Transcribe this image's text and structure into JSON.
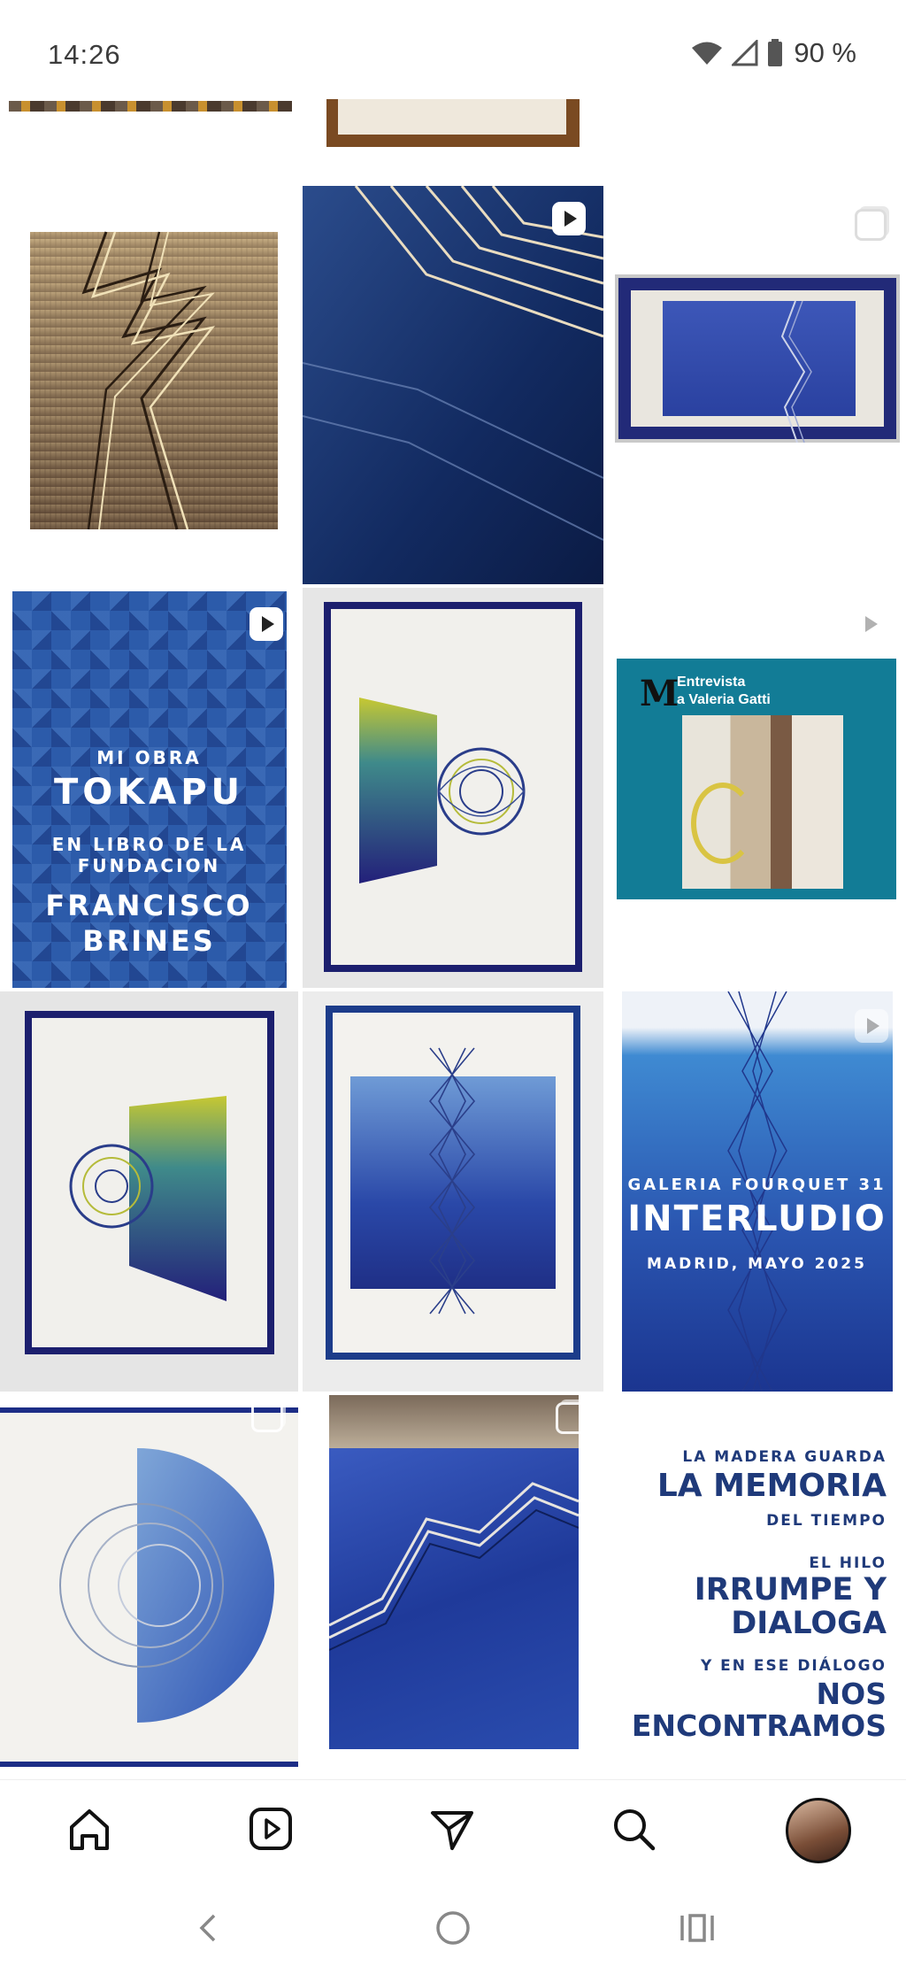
{
  "status_bar": {
    "time": "14:26",
    "battery_percent": "90 %",
    "icons": [
      "wifi-icon",
      "signal-icon",
      "battery-icon"
    ]
  },
  "posts": [
    {
      "name": "weave-top-partial",
      "type": "image"
    },
    {
      "name": "frame-top-partial",
      "type": "image"
    },
    {
      "name": "gold-thread-weave",
      "type": "image"
    },
    {
      "name": "blue-thread-closeup",
      "type": "reel"
    },
    {
      "name": "framed-blue-zigzag",
      "type": "carousel"
    },
    {
      "name": "tokapu-book",
      "type": "reel",
      "lines": [
        "MI OBRA",
        "TOKAPU",
        "EN LIBRO DE LA",
        "FUNDACION",
        "FRANCISCO",
        "BRINES"
      ]
    },
    {
      "name": "framed-spiral-yellow",
      "type": "image"
    },
    {
      "name": "interview-valeria",
      "type": "reel",
      "logo": "M",
      "title_line1": "Entrevista",
      "title_line2": "a Valeria Gatti"
    },
    {
      "name": "framed-spiral-left",
      "type": "image"
    },
    {
      "name": "framed-diamond-weave",
      "type": "image"
    },
    {
      "name": "interludio-poster",
      "type": "reel",
      "line1": "GALERIA FOURQUET 31",
      "line2": "INTERLUDIO",
      "line3": "MADRID, MAYO 2025"
    },
    {
      "name": "half-circle-spiral",
      "type": "carousel"
    },
    {
      "name": "blue-zigzag-table",
      "type": "carousel"
    },
    {
      "name": "memoria-quote",
      "type": "image",
      "lines": [
        "LA MADERA GUARDA",
        "LA MEMORIA",
        "DEL TIEMPO",
        "EL HILO",
        "IRRUMPE Y",
        "DIALOGA",
        "Y EN ESE DIÁLOGO",
        "NOS",
        "ENCONTRAMOS"
      ]
    }
  ],
  "bottom_nav": {
    "items": [
      "home-icon",
      "reels-icon",
      "send-icon",
      "search-icon",
      "profile-avatar"
    ]
  },
  "system_nav": {
    "items": [
      "back-icon",
      "home-circle-icon",
      "recents-icon"
    ]
  },
  "colors": {
    "ink_blue": "#1f3a7a",
    "deep_blue": "#1a2a7a",
    "teal": "#127c96",
    "tokapu_blue": "#2f62b0"
  }
}
